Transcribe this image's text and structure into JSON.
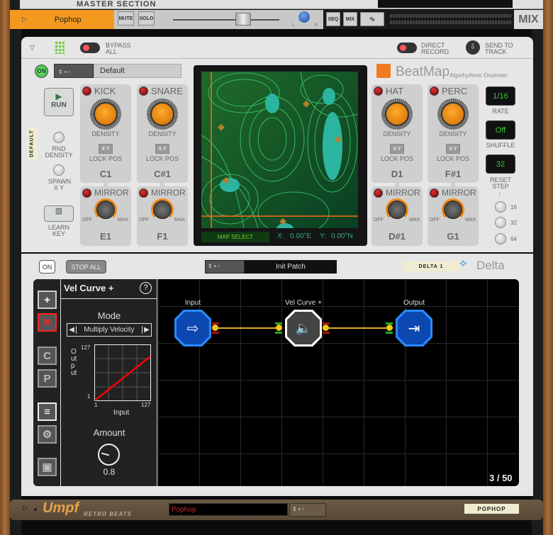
{
  "master": {
    "title": "MASTER SECTION"
  },
  "mixer": {
    "track_name": "Pophop",
    "mute": "MUTE",
    "solo": "SOLO",
    "pan_l": "L",
    "pan_r": "R",
    "seq": "SEQ",
    "mix": "MIX",
    "mix_label": "MIX"
  },
  "beatmap": {
    "bypass": "BYPASS ALL",
    "direct_record": "DIRECT RECORD",
    "send_to_track": "SEND TO TRACK",
    "on": "ON",
    "preset": "Default",
    "brand": "BeatMap",
    "brand_sub": "Algorhythmic Drummer",
    "run": "RUN",
    "tape": "DEFAULT",
    "rnd_density": "RND DENSITY",
    "spawn_xy": "SPAWN X Y",
    "learn_key": "LEARN KEY",
    "channels": [
      {
        "name": "KICK",
        "note": "C1",
        "mirror_note": "E1"
      },
      {
        "name": "SNARE",
        "note": "C#1",
        "mirror_note": "F1"
      },
      {
        "name": "HAT",
        "note": "D1",
        "mirror_note": "D#1"
      },
      {
        "name": "PERC",
        "note": "F#1",
        "mirror_note": "G1"
      }
    ],
    "density": "DENSITY",
    "xy": "X Y",
    "lock_pos": "LOCK POS",
    "mirror": "MIRROR",
    "off": "OFF",
    "max": "MAX",
    "map_select": "MAP SELECT",
    "x_label": "X:",
    "x_value": "0.00°E",
    "y_label": "Y:",
    "y_value": "0.00°N",
    "rate_value": "1/16",
    "rate": "RATE",
    "shuffle_value": "Off",
    "shuffle": "SHUFFLE",
    "reset_value": "32",
    "reset_step": "RESET STEP",
    "reset_options": [
      "16",
      "32",
      "64"
    ]
  },
  "delta": {
    "on": "ON",
    "stop_all": "STOP ALL",
    "preset": "Init Patch",
    "tape": "DELTA 1",
    "brand": "Delta",
    "tools": {
      "add": "+",
      "remove": "✕",
      "c": "C",
      "p": "P"
    },
    "panel": {
      "title": "Vel Curve +",
      "help": "?",
      "mode_label": "Mode",
      "mode_value": "Multiply Velocity",
      "y_axis": "Output",
      "x_axis": "Input",
      "tick_min": "1",
      "tick_max": "127",
      "amount_label": "Amount",
      "amount_value": "0.8"
    },
    "nodes": [
      {
        "label": "Input"
      },
      {
        "label": "Vel Curve +"
      },
      {
        "label": "Output"
      }
    ],
    "page": "3 / 50"
  },
  "umpf": {
    "brand": "Umpf",
    "brand_sub": "RETRO BEATS",
    "preset": "Pophop",
    "tape": "POPHOP"
  },
  "colors": {
    "accent_orange": "#f39a1e",
    "display_green": "#33cc33",
    "node_blue": "#1565d8",
    "umpf_red": "#e02020"
  }
}
